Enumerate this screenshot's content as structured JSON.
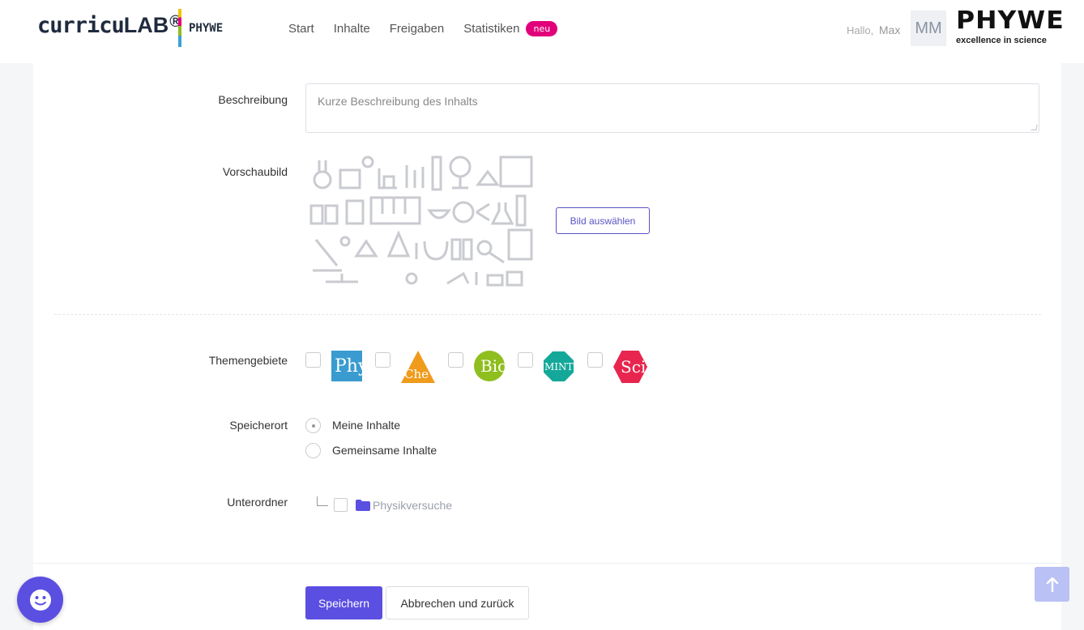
{
  "header": {
    "brand_main": "curricu",
    "brand_lab": "LAB",
    "brand_reg": "®",
    "brand_partner": "PHYWE",
    "nav": [
      {
        "label": "Start"
      },
      {
        "label": "Inhalte"
      },
      {
        "label": "Freigaben"
      },
      {
        "label": "Statistiken"
      }
    ],
    "badge": "neu",
    "greeting": "Hallo,",
    "user_name": "Max",
    "avatar_initials": "MM",
    "logo_text": "PHYWE",
    "logo_tagline": "excellence in science"
  },
  "form": {
    "description": {
      "label": "Beschreibung",
      "placeholder": "Kurze Beschreibung des Inhalts",
      "value": ""
    },
    "preview": {
      "label": "Vorschaubild",
      "button": "Bild auswählen"
    },
    "topics": {
      "label": "Themengebiete",
      "items": [
        {
          "text": "Phy",
          "color": "#3a9bd0",
          "shape": "square",
          "checked": false
        },
        {
          "text": "Che",
          "color": "#ef9b1b",
          "shape": "triangle",
          "checked": false
        },
        {
          "text": "Bio",
          "color": "#8fbe1f",
          "shape": "circle",
          "checked": false
        },
        {
          "text": "MINT",
          "color": "#14a89a",
          "shape": "octagon",
          "checked": false
        },
        {
          "text": "Sci",
          "color": "#e8254e",
          "shape": "hexagon",
          "checked": false
        }
      ]
    },
    "location": {
      "label": "Speicherort",
      "options": [
        {
          "label": "Meine Inhalte",
          "selected": true
        },
        {
          "label": "Gemeinsame Inhalte",
          "selected": false
        }
      ]
    },
    "subfolder": {
      "label": "Unterordner",
      "folder": "Physikversuche",
      "folder_icon": "folder-icon",
      "checked": false
    }
  },
  "footer": {
    "save": "Speichern",
    "cancel": "Abbrechen und zurück"
  },
  "colors": {
    "accent": "#5b4fe2",
    "badge": "#e2007a"
  }
}
